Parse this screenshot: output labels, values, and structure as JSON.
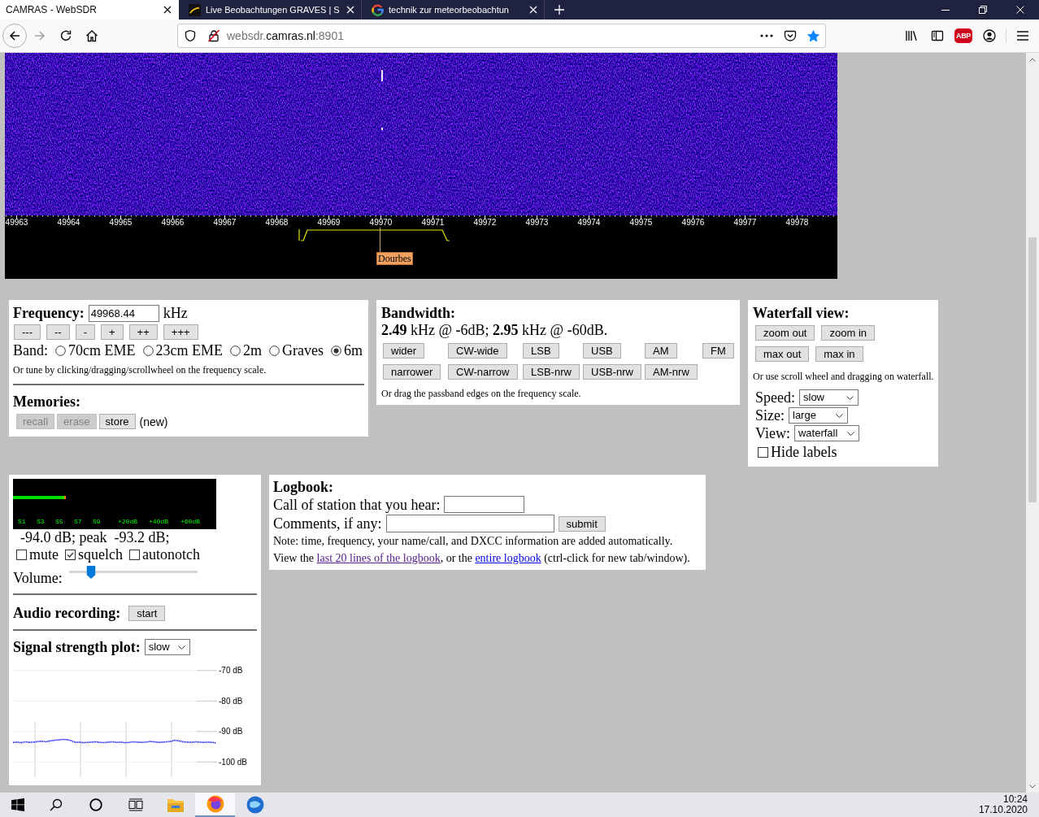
{
  "browser": {
    "tabs": [
      {
        "title": "CAMRAS - WebSDR",
        "kind": "plain",
        "selected": true
      },
      {
        "title": "Live Beobachtungen GRAVES | S",
        "kind": "dark-logo",
        "selected": false
      },
      {
        "title": "technik zur meteorbeobachtun",
        "kind": "google",
        "selected": false
      }
    ],
    "address_bar": {
      "host_prefix": "websdr.",
      "domain": "camras.nl",
      "port": ":8901"
    },
    "toolbar": {
      "adblock_badge": "ABP"
    }
  },
  "waterfall": {
    "scale_labels": [
      "49963",
      "49964",
      "49965",
      "49966",
      "49967",
      "49968",
      "49969",
      "49970",
      "49971",
      "49972",
      "49973",
      "49974",
      "49975",
      "49976",
      "49977",
      "49978"
    ],
    "station_label": "Dourbes"
  },
  "frequency_panel": {
    "heading": "Frequency:",
    "value": "49968.44",
    "unit": "kHz",
    "step_buttons": [
      "---",
      "--",
      "-",
      "+",
      "++",
      "+++"
    ],
    "band_label": "Band:",
    "bands": [
      {
        "label": "70cm EME",
        "selected": false
      },
      {
        "label": "23cm EME",
        "selected": false
      },
      {
        "label": "2m",
        "selected": false
      },
      {
        "label": "Graves",
        "selected": false
      },
      {
        "label": "6m",
        "selected": true
      }
    ],
    "hint": "Or tune by clicking/dragging/scrollwheel on the frequency scale.",
    "memories": {
      "heading": "Memories:",
      "buttons": [
        {
          "label": "recall",
          "disabled": true
        },
        {
          "label": "erase",
          "disabled": true
        },
        {
          "label": "store",
          "disabled": false
        }
      ],
      "status": "(new)"
    }
  },
  "bandwidth_panel": {
    "heading": "Bandwidth:",
    "summary": "**2.49** kHz @ **-**6dB; **2.95** kHz @ **-**60dB.",
    "button_rows": [
      [
        "wider",
        "CW-wide",
        "LSB",
        "USB",
        "AM",
        "FM"
      ],
      [
        "narrower",
        "CW-narrow",
        "LSB-nrw",
        "USB-nrw",
        "AM-nrw"
      ]
    ],
    "hint": "Or drag the passband edges on the frequency scale."
  },
  "waterfall_view_panel": {
    "heading": "Waterfall view:",
    "button_rows": [
      [
        "zoom out",
        "zoom in"
      ],
      [
        "max out",
        "max in"
      ]
    ],
    "hint": "Or use scroll wheel and dragging on waterfall.",
    "selects": [
      {
        "label": "Speed:",
        "value": "slow"
      },
      {
        "label": "Size:",
        "value": "large"
      },
      {
        "label": "View:",
        "value": "waterfall"
      }
    ],
    "hide_labels": {
      "label": "Hide labels",
      "checked": false
    }
  },
  "audio_panel": {
    "s_meter": {
      "level": 0.26,
      "scale_labels": [
        "S1",
        "S3",
        "S5",
        "S7",
        "S9",
        "+20dB",
        "+40dB",
        "+60dB"
      ]
    },
    "reading": "-94.0 dB; peak  -93.2 dB;",
    "options": [
      {
        "label": "mute",
        "checked": false
      },
      {
        "label": "squelch",
        "checked": true
      },
      {
        "label": "autonotch",
        "checked": false
      }
    ],
    "volume": {
      "label": "Volume:",
      "level": 0.17
    },
    "recording": {
      "label": "Audio recording:",
      "button": "start"
    },
    "signal_plot": {
      "label": "Signal strength plot:",
      "speed": "slow",
      "chart_data": {
        "type": "line",
        "ylim": [
          -100,
          -70
        ],
        "yticks": [
          {
            "value": -70,
            "label": "-70 dB"
          },
          {
            "value": -80,
            "label": "-80 dB"
          },
          {
            "value": -90,
            "label": "-90 dB"
          },
          {
            "value": -100,
            "label": "-100 dB"
          }
        ],
        "grid": true,
        "series": [
          {
            "color": "#0000ff",
            "line_style": "dotted",
            "values": [
              -93.6,
              -93.5,
              -93.7,
              -93.4,
              -93.6,
              -93.5,
              -93.3,
              -93.2,
              -93.4,
              -93.1,
              -92.9,
              -92.8,
              -92.6,
              -92.7,
              -93.0,
              -93.6,
              -93.5,
              -93.7,
              -93.6,
              -93.5,
              -93.4,
              -93.6,
              -93.7,
              -93.5,
              -93.4,
              -93.6,
              -93.5,
              -93.7,
              -93.6,
              -93.4,
              -93.5,
              -93.6,
              -93.5,
              -93.3,
              -93.4,
              -93.6,
              -93.5,
              -93.4,
              -93.3,
              -92.9,
              -93.1,
              -93.4,
              -93.5,
              -93.6,
              -93.4,
              -93.5,
              -93.6,
              -93.5,
              -93.6,
              -93.8
            ]
          }
        ]
      }
    }
  },
  "logbook": {
    "heading": "Logbook:",
    "call_label": "Call of station that you hear:",
    "comments_label": "Comments, if any:",
    "submit": "submit",
    "note": "Note: time, frequency, your name/call, and DXCC information are added automatically.",
    "view_text": [
      {
        "kind": "text",
        "text": "View the "
      },
      {
        "kind": "link",
        "text": "last 20 lines of the logbook",
        "visited": true
      },
      {
        "kind": "text",
        "text": ", or the "
      },
      {
        "kind": "link",
        "text": "entire logbook",
        "visited": false
      },
      {
        "kind": "text",
        "text": " (ctrl-click for new tab/window)."
      }
    ]
  },
  "taskbar": {
    "apps": [
      {
        "kind": "folder",
        "selected": false
      },
      {
        "kind": "browser",
        "selected": true
      },
      {
        "kind": "globe",
        "selected": false
      }
    ],
    "time": "10:24",
    "date": "17.10.2020"
  }
}
